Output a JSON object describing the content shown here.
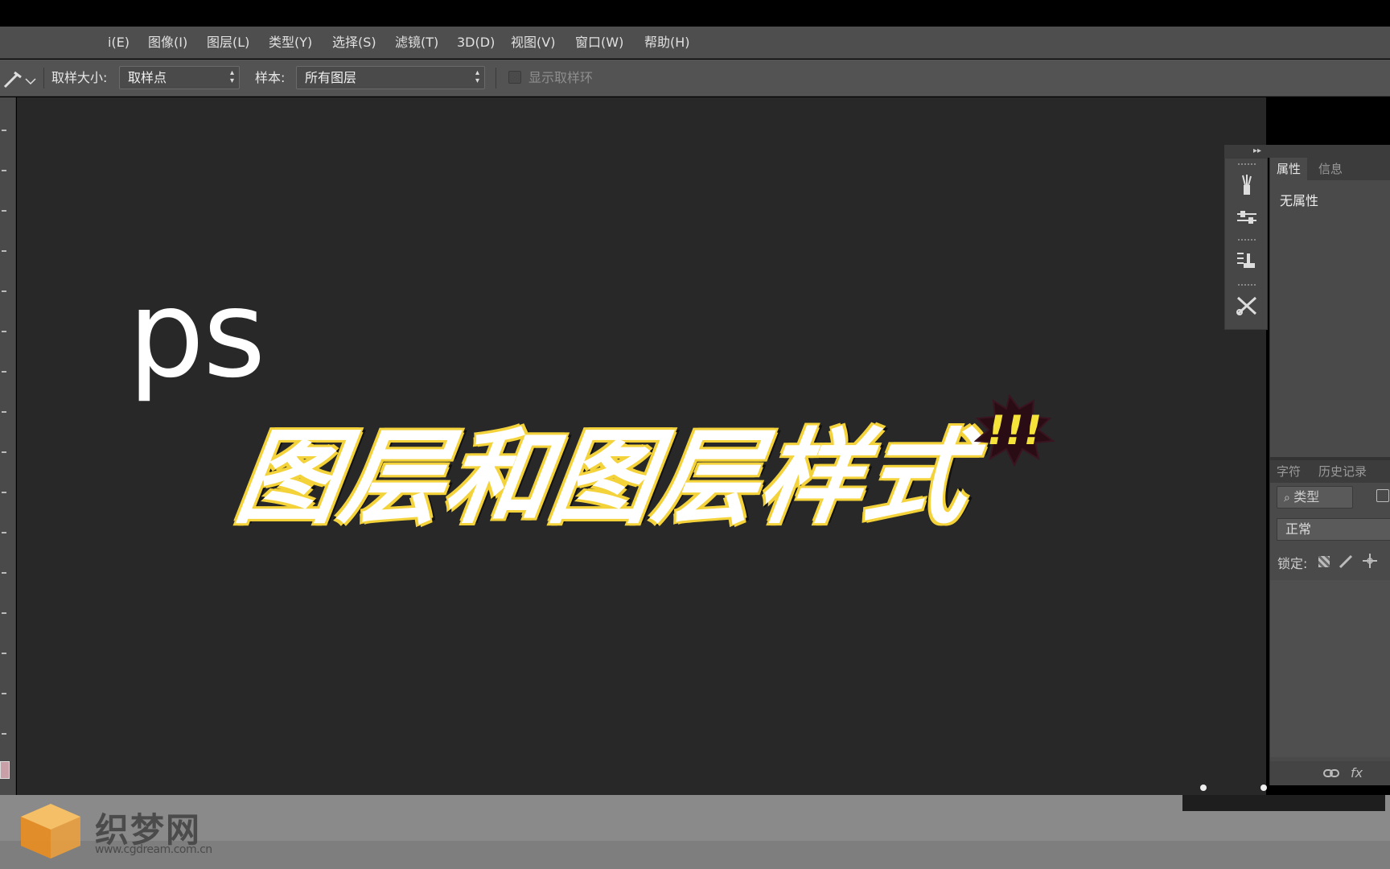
{
  "menubar": {
    "items": [
      "i(E)",
      "图像(I)",
      "图层(L)",
      "类型(Y)",
      "选择(S)",
      "滤镜(T)",
      "3D(D)",
      "视图(V)",
      "窗口(W)",
      "帮助(H)"
    ]
  },
  "options": {
    "sample_size_label": "取样大小:",
    "sample_size_value": "取样点",
    "sample_label": "样本:",
    "sample_value": "所有图层",
    "show_ring_label": "显示取样环"
  },
  "canvas": {
    "ps_text": "ps",
    "title_text": "图层和图层样式",
    "burst_text": "!!!"
  },
  "properties_panel": {
    "tabs": [
      "属性",
      "信息"
    ],
    "empty_text": "无属性"
  },
  "layers_panel": {
    "tabs": [
      "字符",
      "历史记录"
    ],
    "kind_value": "类型",
    "blend_value": "正常",
    "lock_label": "锁定:",
    "fx_label": "fx"
  },
  "watermark": {
    "name": "织梦网",
    "url": "www.cgdream.com.cn"
  },
  "colors": {
    "canvas_bg": "#282828",
    "title_outline": "#f4d23a",
    "burst_fill": "#f6e33a",
    "foreground_swatch": "#c9a0a8"
  }
}
